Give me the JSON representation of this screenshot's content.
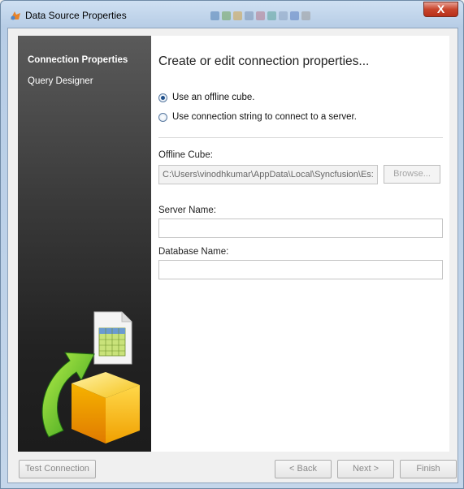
{
  "window": {
    "title": "Data Source Properties",
    "close_label": "X"
  },
  "sidebar": {
    "items": [
      {
        "label": "Connection Properties",
        "active": true
      },
      {
        "label": "Query Designer",
        "active": false
      }
    ]
  },
  "main": {
    "heading": "Create or edit connection properties...",
    "options": [
      {
        "label": "Use an offline cube.",
        "checked": true
      },
      {
        "label": "Use connection string to connect to a server.",
        "checked": false
      }
    ],
    "offline_cube": {
      "label": "Offline Cube:",
      "value": "C:\\Users\\vinodhkumar\\AppData\\Local\\Syncfusion\\Es:",
      "browse_label": "Browse..."
    },
    "server_name": {
      "label": "Server Name:",
      "value": ""
    },
    "database_name": {
      "label": "Database Name:",
      "value": ""
    }
  },
  "footer": {
    "test_label": "Test Connection",
    "back_label": "< Back",
    "next_label": "Next >",
    "finish_label": "Finish"
  },
  "colors": {
    "title_bar": "#c4d6ea",
    "sidebar_top": "#5a5a5a",
    "sidebar_bottom": "#1c1c1c",
    "close_button": "#c8452c",
    "radio_accent": "#1f4f8a"
  },
  "icons": [
    "app-icon",
    "close-icon",
    "cube-illustration",
    "spreadsheet-icon",
    "arrow-icon"
  ]
}
